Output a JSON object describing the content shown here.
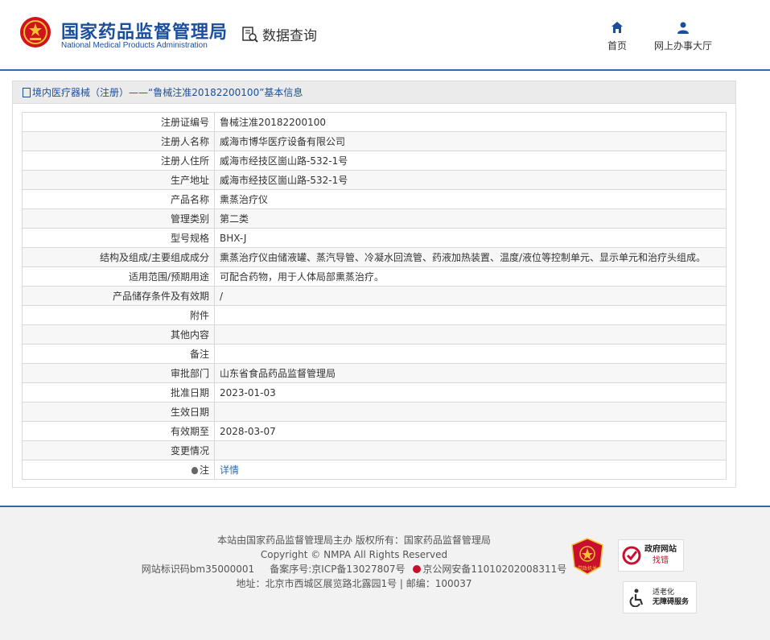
{
  "header": {
    "title_cn": "国家药品监督管理局",
    "title_en": "National Medical Products Administration",
    "data_query": "数据查询",
    "nav": {
      "home": "首页",
      "online_hall": "网上办事大厅"
    }
  },
  "panel": {
    "breadcrumb": "境内医疗器械（注册）——“鲁械注准20182200100”基本信息",
    "rows": [
      {
        "label": "注册证编号",
        "value": "鲁械注准20182200100"
      },
      {
        "label": "注册人名称",
        "value": "威海市博华医疗设备有限公司"
      },
      {
        "label": "注册人住所",
        "value": "威海市经技区崮山路-532-1号"
      },
      {
        "label": "生产地址",
        "value": "威海市经技区崮山路-532-1号"
      },
      {
        "label": "产品名称",
        "value": "熏蒸治疗仪"
      },
      {
        "label": "管理类别",
        "value": "第二类"
      },
      {
        "label": "型号规格",
        "value": "BHX-J"
      },
      {
        "label": "结构及组成/主要组成成分",
        "value": "熏蒸治疗仪由储液罐、蒸汽导管、冷凝水回流管、药液加热装置、温度/液位等控制单元、显示单元和治疗头组成。"
      },
      {
        "label": "适用范围/预期用途",
        "value": "可配合药物，用于人体局部熏蒸治疗。"
      },
      {
        "label": "产品储存条件及有效期",
        "value": "/"
      },
      {
        "label": "附件",
        "value": ""
      },
      {
        "label": "其他内容",
        "value": ""
      },
      {
        "label": "备注",
        "value": ""
      },
      {
        "label": "审批部门",
        "value": "山东省食品药品监督管理局"
      },
      {
        "label": "批准日期",
        "value": "2023-01-03"
      },
      {
        "label": "生效日期",
        "value": ""
      },
      {
        "label": "有效期至",
        "value": "2028-03-07"
      },
      {
        "label": "变更情况",
        "value": ""
      }
    ],
    "note": {
      "label": "注",
      "link": "详情"
    }
  },
  "footer": {
    "line1": "本站由国家药品监督管理局主办 版权所有：国家药品监督管理局",
    "line2": "Copyright © NMPA All Rights Reserved",
    "line3_site_id": "网站标识码bm35000001",
    "line3_icp": "备案序号:京ICP备13027807号",
    "line3_police": "京公网安备11010202008311号",
    "line4": "地址：北京市西城区展览路北露园1号 | 邮编：100037",
    "badge_party": "党政机关",
    "badge_gov_line1": "政府网站",
    "badge_gov_line2": "找错",
    "badge_access_line1": "适老化",
    "badge_access_line2": "无障碍服务"
  },
  "colors": {
    "brand_blue": "#1b4f9c",
    "link_blue": "#2a6cb4",
    "emblem_red": "#d0141c",
    "gold": "#f2c230"
  }
}
